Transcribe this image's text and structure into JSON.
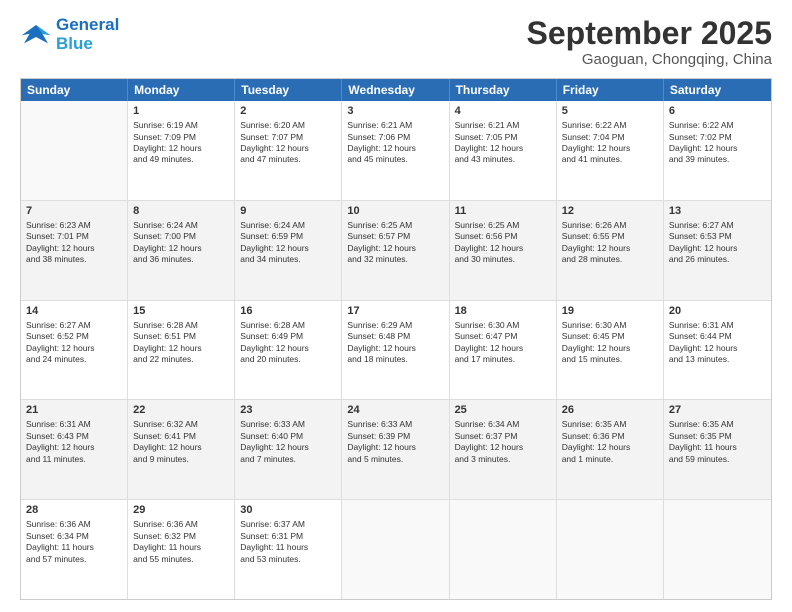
{
  "logo": {
    "line1": "General",
    "line2": "Blue"
  },
  "header": {
    "month": "September 2025",
    "location": "Gaoguan, Chongqing, China"
  },
  "weekdays": [
    "Sunday",
    "Monday",
    "Tuesday",
    "Wednesday",
    "Thursday",
    "Friday",
    "Saturday"
  ],
  "rows": [
    [
      {
        "num": "",
        "text": "",
        "empty": true
      },
      {
        "num": "1",
        "text": "Sunrise: 6:19 AM\nSunset: 7:09 PM\nDaylight: 12 hours\nand 49 minutes."
      },
      {
        "num": "2",
        "text": "Sunrise: 6:20 AM\nSunset: 7:07 PM\nDaylight: 12 hours\nand 47 minutes."
      },
      {
        "num": "3",
        "text": "Sunrise: 6:21 AM\nSunset: 7:06 PM\nDaylight: 12 hours\nand 45 minutes."
      },
      {
        "num": "4",
        "text": "Sunrise: 6:21 AM\nSunset: 7:05 PM\nDaylight: 12 hours\nand 43 minutes."
      },
      {
        "num": "5",
        "text": "Sunrise: 6:22 AM\nSunset: 7:04 PM\nDaylight: 12 hours\nand 41 minutes."
      },
      {
        "num": "6",
        "text": "Sunrise: 6:22 AM\nSunset: 7:02 PM\nDaylight: 12 hours\nand 39 minutes."
      }
    ],
    [
      {
        "num": "7",
        "text": "Sunrise: 6:23 AM\nSunset: 7:01 PM\nDaylight: 12 hours\nand 38 minutes.",
        "shaded": true
      },
      {
        "num": "8",
        "text": "Sunrise: 6:24 AM\nSunset: 7:00 PM\nDaylight: 12 hours\nand 36 minutes.",
        "shaded": true
      },
      {
        "num": "9",
        "text": "Sunrise: 6:24 AM\nSunset: 6:59 PM\nDaylight: 12 hours\nand 34 minutes.",
        "shaded": true
      },
      {
        "num": "10",
        "text": "Sunrise: 6:25 AM\nSunset: 6:57 PM\nDaylight: 12 hours\nand 32 minutes.",
        "shaded": true
      },
      {
        "num": "11",
        "text": "Sunrise: 6:25 AM\nSunset: 6:56 PM\nDaylight: 12 hours\nand 30 minutes.",
        "shaded": true
      },
      {
        "num": "12",
        "text": "Sunrise: 6:26 AM\nSunset: 6:55 PM\nDaylight: 12 hours\nand 28 minutes.",
        "shaded": true
      },
      {
        "num": "13",
        "text": "Sunrise: 6:27 AM\nSunset: 6:53 PM\nDaylight: 12 hours\nand 26 minutes.",
        "shaded": true
      }
    ],
    [
      {
        "num": "14",
        "text": "Sunrise: 6:27 AM\nSunset: 6:52 PM\nDaylight: 12 hours\nand 24 minutes."
      },
      {
        "num": "15",
        "text": "Sunrise: 6:28 AM\nSunset: 6:51 PM\nDaylight: 12 hours\nand 22 minutes."
      },
      {
        "num": "16",
        "text": "Sunrise: 6:28 AM\nSunset: 6:49 PM\nDaylight: 12 hours\nand 20 minutes."
      },
      {
        "num": "17",
        "text": "Sunrise: 6:29 AM\nSunset: 6:48 PM\nDaylight: 12 hours\nand 18 minutes."
      },
      {
        "num": "18",
        "text": "Sunrise: 6:30 AM\nSunset: 6:47 PM\nDaylight: 12 hours\nand 17 minutes."
      },
      {
        "num": "19",
        "text": "Sunrise: 6:30 AM\nSunset: 6:45 PM\nDaylight: 12 hours\nand 15 minutes."
      },
      {
        "num": "20",
        "text": "Sunrise: 6:31 AM\nSunset: 6:44 PM\nDaylight: 12 hours\nand 13 minutes."
      }
    ],
    [
      {
        "num": "21",
        "text": "Sunrise: 6:31 AM\nSunset: 6:43 PM\nDaylight: 12 hours\nand 11 minutes.",
        "shaded": true
      },
      {
        "num": "22",
        "text": "Sunrise: 6:32 AM\nSunset: 6:41 PM\nDaylight: 12 hours\nand 9 minutes.",
        "shaded": true
      },
      {
        "num": "23",
        "text": "Sunrise: 6:33 AM\nSunset: 6:40 PM\nDaylight: 12 hours\nand 7 minutes.",
        "shaded": true
      },
      {
        "num": "24",
        "text": "Sunrise: 6:33 AM\nSunset: 6:39 PM\nDaylight: 12 hours\nand 5 minutes.",
        "shaded": true
      },
      {
        "num": "25",
        "text": "Sunrise: 6:34 AM\nSunset: 6:37 PM\nDaylight: 12 hours\nand 3 minutes.",
        "shaded": true
      },
      {
        "num": "26",
        "text": "Sunrise: 6:35 AM\nSunset: 6:36 PM\nDaylight: 12 hours\nand 1 minute.",
        "shaded": true
      },
      {
        "num": "27",
        "text": "Sunrise: 6:35 AM\nSunset: 6:35 PM\nDaylight: 11 hours\nand 59 minutes.",
        "shaded": true
      }
    ],
    [
      {
        "num": "28",
        "text": "Sunrise: 6:36 AM\nSunset: 6:34 PM\nDaylight: 11 hours\nand 57 minutes."
      },
      {
        "num": "29",
        "text": "Sunrise: 6:36 AM\nSunset: 6:32 PM\nDaylight: 11 hours\nand 55 minutes."
      },
      {
        "num": "30",
        "text": "Sunrise: 6:37 AM\nSunset: 6:31 PM\nDaylight: 11 hours\nand 53 minutes."
      },
      {
        "num": "",
        "text": "",
        "empty": true
      },
      {
        "num": "",
        "text": "",
        "empty": true
      },
      {
        "num": "",
        "text": "",
        "empty": true
      },
      {
        "num": "",
        "text": "",
        "empty": true
      }
    ]
  ]
}
